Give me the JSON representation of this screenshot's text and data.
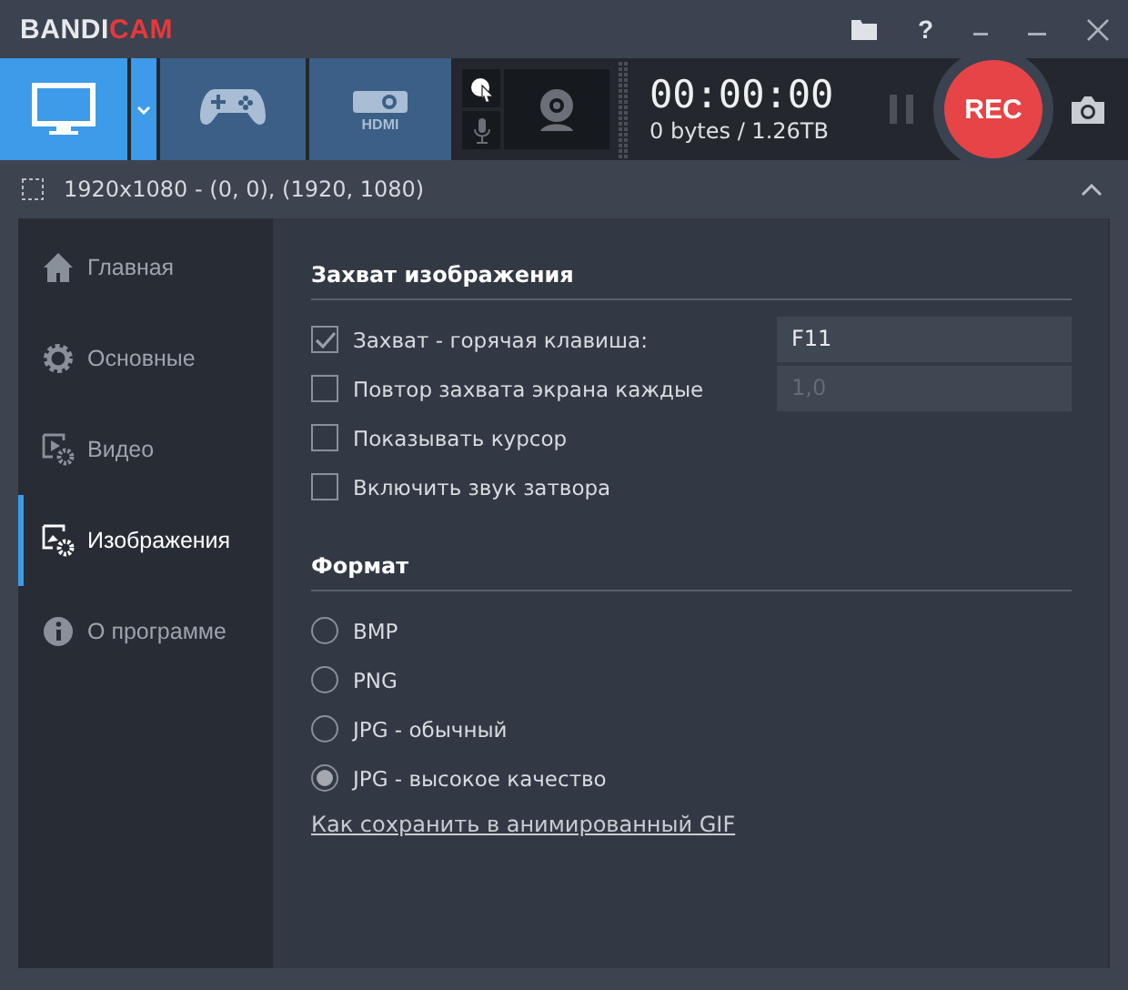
{
  "window": {
    "logo_main": "BANDI",
    "logo_accent": "CAM",
    "help_label": "?"
  },
  "modes": [
    {
      "kind": "screen",
      "selected": true
    },
    {
      "kind": "game",
      "selected": false
    },
    {
      "kind": "hdmi",
      "selected": false,
      "label": "HDMI"
    }
  ],
  "recorder": {
    "time": "00:00:00",
    "size": "0 bytes / 1.26TB",
    "rec_label": "REC"
  },
  "area": {
    "text": "1920x1080 - (0, 0), (1920, 1080)"
  },
  "sidebar": {
    "items": [
      {
        "kind": "home",
        "label": "Главная",
        "selected": false
      },
      {
        "kind": "general",
        "label": "Основные",
        "selected": false
      },
      {
        "kind": "video",
        "label": "Видео",
        "selected": false
      },
      {
        "kind": "image",
        "label": "Изображения",
        "selected": true
      },
      {
        "kind": "about",
        "label": "О программе",
        "selected": false
      }
    ]
  },
  "capture": {
    "title": "Захват изображения",
    "options": [
      {
        "label": "Захват - горячая клавиша:",
        "checked": true,
        "field": {
          "value": "F11",
          "disabled": false
        }
      },
      {
        "label": "Повтор захвата экрана каждые",
        "checked": false,
        "field": {
          "value": "1,0",
          "disabled": true
        }
      },
      {
        "label": "Показывать курсор",
        "checked": false
      },
      {
        "label": "Включить звук затвора",
        "checked": false
      }
    ]
  },
  "format": {
    "title": "Формат",
    "options": [
      {
        "label": "BMP",
        "selected": false
      },
      {
        "label": "PNG",
        "selected": false
      },
      {
        "label": "JPG - обычный",
        "selected": false
      },
      {
        "label": "JPG - высокое качество",
        "selected": true
      }
    ],
    "link": "Как сохранить в анимированный GIF"
  }
}
